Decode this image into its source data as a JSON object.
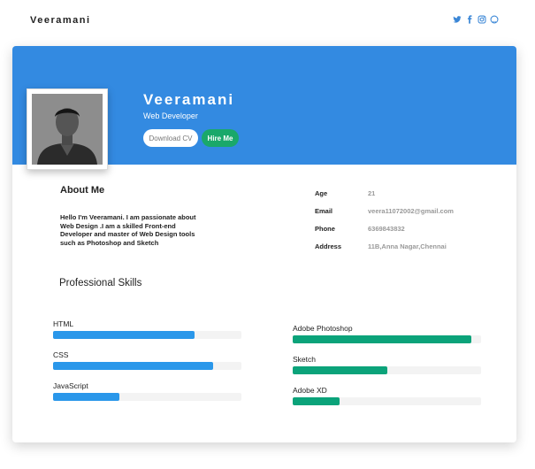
{
  "nav": {
    "brand": "Veeramani",
    "social": [
      {
        "icon": "twitter-icon",
        "glyph": "t"
      },
      {
        "icon": "facebook-icon",
        "glyph": "f"
      },
      {
        "icon": "instagram-icon",
        "glyph": "ig"
      },
      {
        "icon": "github-icon",
        "glyph": "gh"
      }
    ]
  },
  "profile": {
    "name": "Veeramani",
    "role": "Web Developer",
    "download_label": "Download CV",
    "hire_label": "Hire Me"
  },
  "about": {
    "title": "About Me",
    "text": "Hello I'm Veeramani. I am passionate about Web Design .I am a skilled Front-end Developer and master of Web Design tools such as Photoshop and Sketch"
  },
  "info": [
    {
      "label": "Age",
      "value": "21"
    },
    {
      "label": "Email",
      "value": "veera11072002@gmail.com"
    },
    {
      "label": "Phone",
      "value": "6369843832"
    },
    {
      "label": "Address",
      "value": "11B,Anna Nagar,Chennai"
    }
  ],
  "skills": {
    "title": "Professional Skills",
    "left": [
      {
        "name": "HTML",
        "level": 0.75
      },
      {
        "name": "CSS",
        "level": 0.85
      },
      {
        "name": "JavaScript",
        "level": 0.35
      }
    ],
    "right": [
      {
        "name": "Adobe Photoshop",
        "level": 0.95
      },
      {
        "name": "Sketch",
        "level": 0.5
      },
      {
        "name": "Adobe XD",
        "level": 0.25
      }
    ]
  },
  "colors": {
    "banner": "#338ae1",
    "accent_green": "#1aa86a",
    "skill_blue": "#2a97ea",
    "skill_green": "#0ba37a"
  }
}
